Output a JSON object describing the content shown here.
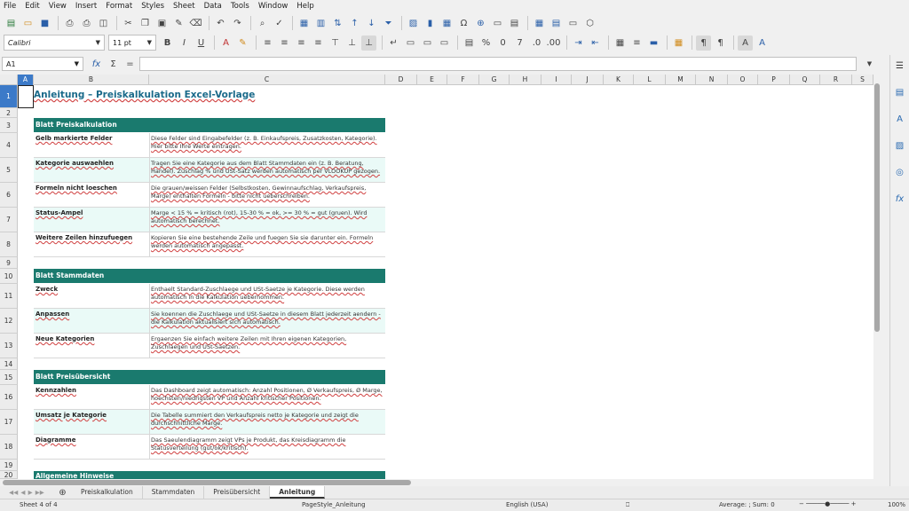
{
  "menu": [
    "File",
    "Edit",
    "View",
    "Insert",
    "Format",
    "Styles",
    "Sheet",
    "Data",
    "Tools",
    "Window",
    "Help"
  ],
  "toolbar2": {
    "font_name": "Calibri",
    "font_size": "11 pt"
  },
  "formula": {
    "name_box": "A1",
    "fx": "fx",
    "sum": "Σ",
    "equals": "="
  },
  "columns": [
    "A",
    "B",
    "C",
    "D",
    "E",
    "F",
    "G",
    "H",
    "I",
    "J",
    "K",
    "L",
    "M",
    "N",
    "O",
    "P",
    "Q",
    "R",
    "S"
  ],
  "rows": [
    "1",
    "2",
    "3",
    "4",
    "5",
    "6",
    "7",
    "8",
    "9",
    "10",
    "11",
    "12",
    "13",
    "14",
    "15",
    "16",
    "17",
    "18",
    "19",
    "20"
  ],
  "title": "Anleitung – Preiskalkulation Excel-Vorlage",
  "sections": [
    {
      "header": "Blatt Preiskalkulation",
      "rows": [
        {
          "a": "Gelb markierte Felder",
          "c": "Diese Felder sind Eingabefelder (z. B. Einkaufspreis, Zusatzkosten, Kategorie). Hier bitte Ihre Werte eintragen."
        },
        {
          "a": "Kategorie auswaehlen",
          "c": "Tragen Sie eine Kategorie aus dem Blatt Stammdaten ein (z. B. Beratung, Handel). Zuschlag % und USt-Satz werden automatisch per VLOOKUP gezogen."
        },
        {
          "a": "Formeln nicht loeschen",
          "c": "Die grauen/weissen Felder (Selbstkosten, Gewinnaufschlag, Verkaufspreis, Marge) enthalten Formeln - bitte nicht ueberschreiben."
        },
        {
          "a": "Status-Ampel",
          "c": "Marge < 15 % = kritisch (rot), 15-30 % = ok, >= 30 % = gut (gruen). Wird automatisch berechnet."
        },
        {
          "a": "Weitere Zeilen hinzufuegen",
          "c": "Kopieren Sie eine bestehende Zeile und fuegen Sie sie darunter ein. Formeln werden automatisch angepasst."
        }
      ]
    },
    {
      "header": "Blatt Stammdaten",
      "rows": [
        {
          "a": "Zweck",
          "c": "Enthaelt Standard-Zuschlaege und USt-Saetze je Kategorie. Diese werden automatisch in die Kalkulation uebernommen."
        },
        {
          "a": "Anpassen",
          "c": "Sie koennen die Zuschlaege und USt-Saetze in diesem Blatt jederzeit aendern - die Kalkulation aktualisiert sich automatisch."
        },
        {
          "a": "Neue Kategorien",
          "c": "Ergaenzen Sie einfach weitere Zeilen mit Ihren eigenen Kategorien, Zuschlaegen und USt-Saetzen."
        }
      ]
    },
    {
      "header": "Blatt Preisübersicht",
      "rows": [
        {
          "a": "Kennzahlen",
          "c": "Das Dashboard zeigt automatisch: Anzahl Positionen, Ø Verkaufspreis, Ø Marge, hoechsten/niedrigsten VP und Anzahl kritischer Positionen."
        },
        {
          "a": "Umsatz je Kategorie",
          "c": "Die Tabelle summiert den Verkaufspreis netto je Kategorie und zeigt die durchschnittliche Marge."
        },
        {
          "a": "Diagramme",
          "c": "Das Saeulendiagramm zeigt VPs je Produkt, das Kreisdiagramm die Statusverteilung (gut/ok/kritisch)."
        }
      ]
    },
    {
      "header": "Allgemeine Hinweise",
      "rows": []
    }
  ],
  "tabs": [
    "Preiskalkulation",
    "Stammdaten",
    "Preisübersicht",
    "Anleitung"
  ],
  "status": {
    "sheet": "Sheet 4 of 4",
    "page_style": "PageStyle_Anleitung",
    "language": "English (USA)",
    "summary": "Average: ; Sum: 0",
    "zoom": "100%"
  }
}
